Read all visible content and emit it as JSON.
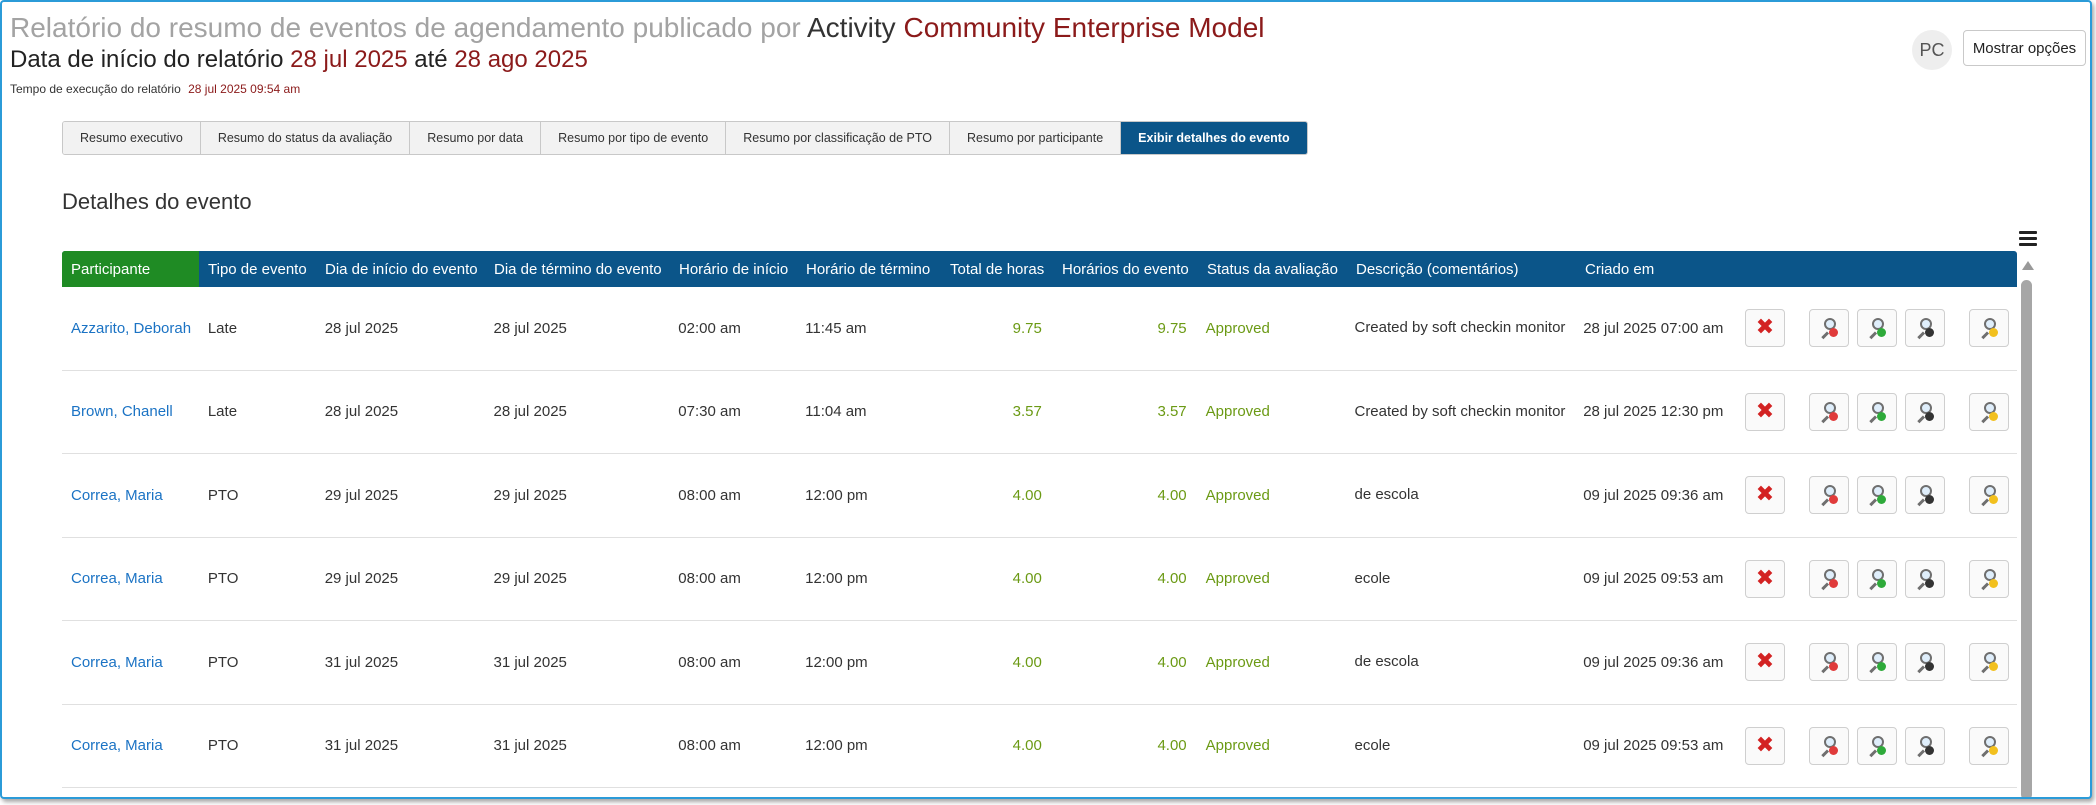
{
  "header": {
    "title_prefix": "Relatório do resumo de eventos de agendamento publicado por",
    "title_activity": "Activity",
    "title_model": "Community Enterprise Model",
    "date_label": "Data de início do relatório",
    "start_date": "28 jul 2025",
    "until_label": "até",
    "end_date": "28 ago 2025",
    "exec_label": "Tempo de execução do relatório",
    "exec_time": "28 jul 2025 09:54 am"
  },
  "user": {
    "initials": "PC"
  },
  "options_button": "Mostrar opções",
  "tabs": [
    {
      "label": "Resumo executivo"
    },
    {
      "label": "Resumo do status da avaliação"
    },
    {
      "label": "Resumo por data"
    },
    {
      "label": "Resumo por tipo de evento"
    },
    {
      "label": "Resumo por classificação de PTO"
    },
    {
      "label": "Resumo por participante"
    },
    {
      "label": "Exibir detalhes do evento"
    }
  ],
  "active_tab": "Exibir detalhes do evento",
  "section_title": "Detalhes do evento",
  "table": {
    "columns": [
      "Participante",
      "Tipo de evento",
      "Dia de início do evento",
      "Dia de término do evento",
      "Horário de início",
      "Horário de término",
      "Total de horas",
      "Horários do evento",
      "Status da avaliação",
      "Descrição (comentários)",
      "Criado em"
    ],
    "rows": [
      [
        "Azzarito, Deborah",
        "Late",
        "28 jul 2025",
        "28 jul 2025",
        "02:00 am",
        "11:45 am",
        "9.75",
        "9.75",
        "Approved",
        "Created by soft checkin monitor",
        "28 jul 2025 07:00 am"
      ],
      [
        "Brown, Chanell",
        "Late",
        "28 jul 2025",
        "28 jul 2025",
        "07:30 am",
        "11:04 am",
        "3.57",
        "3.57",
        "Approved",
        "Created by soft checkin monitor",
        "28 jul 2025 12:30 pm"
      ],
      [
        "Correa, Maria",
        "PTO",
        "29 jul 2025",
        "29 jul 2025",
        "08:00 am",
        "12:00 pm",
        "4.00",
        "4.00",
        "Approved",
        "de escola",
        "09 jul 2025 09:36 am"
      ],
      [
        "Correa, Maria",
        "PTO",
        "29 jul 2025",
        "29 jul 2025",
        "08:00 am",
        "12:00 pm",
        "4.00",
        "4.00",
        "Approved",
        "ecole",
        "09 jul 2025 09:53 am"
      ],
      [
        "Correa, Maria",
        "PTO",
        "31 jul 2025",
        "31 jul 2025",
        "08:00 am",
        "12:00 pm",
        "4.00",
        "4.00",
        "Approved",
        "de escola",
        "09 jul 2025 09:36 am"
      ],
      [
        "Correa, Maria",
        "PTO",
        "31 jul 2025",
        "31 jul 2025",
        "08:00 am",
        "12:00 pm",
        "4.00",
        "4.00",
        "Approved",
        "ecole",
        "09 jul 2025 09:53 am"
      ]
    ]
  },
  "icons": {
    "delete": "delete-x-icon",
    "view_red": "view-red-icon",
    "view_green": "view-green-icon",
    "view_dark": "view-dark-icon",
    "view_yellow": "view-yellow-icon",
    "menu": "hamburger-menu-icon"
  },
  "colors": {
    "header_bg": "#0b5589",
    "first_col_bg": "#1f8b24",
    "link": "#1b73c4",
    "approved": "#6b9a14",
    "title_red": "#8b1a1a",
    "delete": "#d32222"
  }
}
